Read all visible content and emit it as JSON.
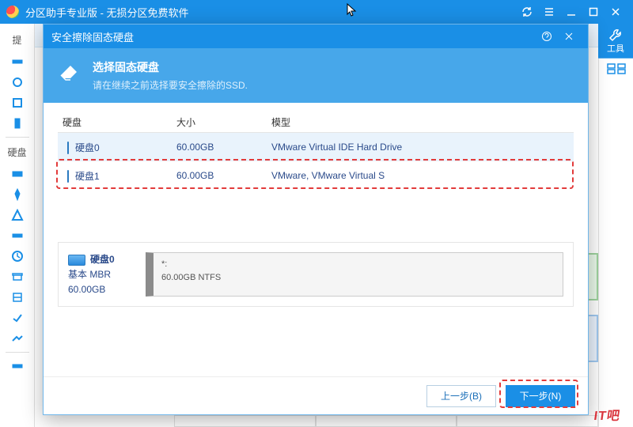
{
  "titlebar": {
    "title": "分区助手专业版 - 无损分区免费软件"
  },
  "sidebar": {
    "prompt_label": "提",
    "section_label": "硬盘"
  },
  "rightbar": {
    "tool_label": "工具"
  },
  "dialog": {
    "title": "安全擦除固态硬盘",
    "heading": "选择固态硬盘",
    "subheading": "请在继续之前选择要安全擦除的SSD.",
    "columns": {
      "disk": "硬盘",
      "size": "大小",
      "model": "模型"
    },
    "rows": [
      {
        "name": "硬盘0",
        "size": "60.00GB",
        "model": "VMware Virtual IDE Hard Drive"
      },
      {
        "name": "硬盘1",
        "size": "60.00GB",
        "model": "VMware, VMware Virtual S"
      }
    ],
    "detail": {
      "name": "硬盘0",
      "type": "基本 MBR",
      "size": "60.00GB",
      "part_label": "*:",
      "part_info": "60.00GB NTFS"
    },
    "buttons": {
      "prev": "上一步(B)",
      "next": "下一步(N)"
    }
  },
  "watermark": "IT吧"
}
